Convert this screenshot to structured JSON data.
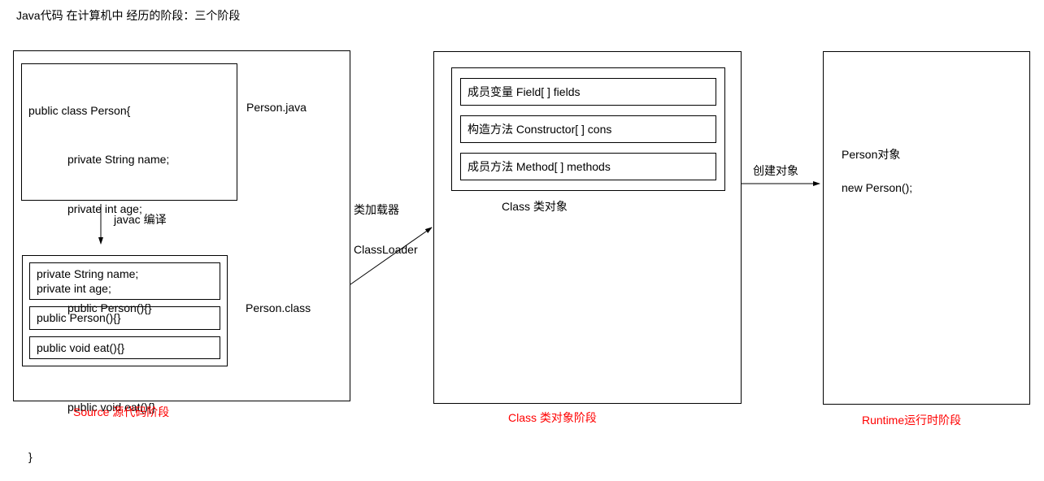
{
  "title": "Java代码 在计算机中 经历的阶段：三个阶段",
  "stage1": {
    "code": {
      "l1": "public class Person{",
      "l2": "private String name;",
      "l3": "private int age;",
      "l4": "public Person(){}",
      "l5": "public void eat(){}",
      "l6": "}"
    },
    "fileJava": "Person.java",
    "compile": "javac 编译",
    "compiled": {
      "r1": "private String name;\nprivate int age;",
      "r2": "public Person(){}",
      "r3": "public void eat(){}"
    },
    "fileClass": "Person.class",
    "label": "Source 源代码阶段"
  },
  "loader": {
    "l1": "类加载器",
    "l2": "ClassLoader"
  },
  "stage2": {
    "row1": "成员变量  Field[ ] fields",
    "row2": "构造方法  Constructor[ ] cons",
    "row3": "成员方法 Method[ ] methods",
    "caption": "Class 类对象",
    "label": "Class 类对象阶段"
  },
  "create": "创建对象",
  "stage3": {
    "t1": "Person对象",
    "t2": "new Person();",
    "label": "Runtime运行时阶段"
  }
}
